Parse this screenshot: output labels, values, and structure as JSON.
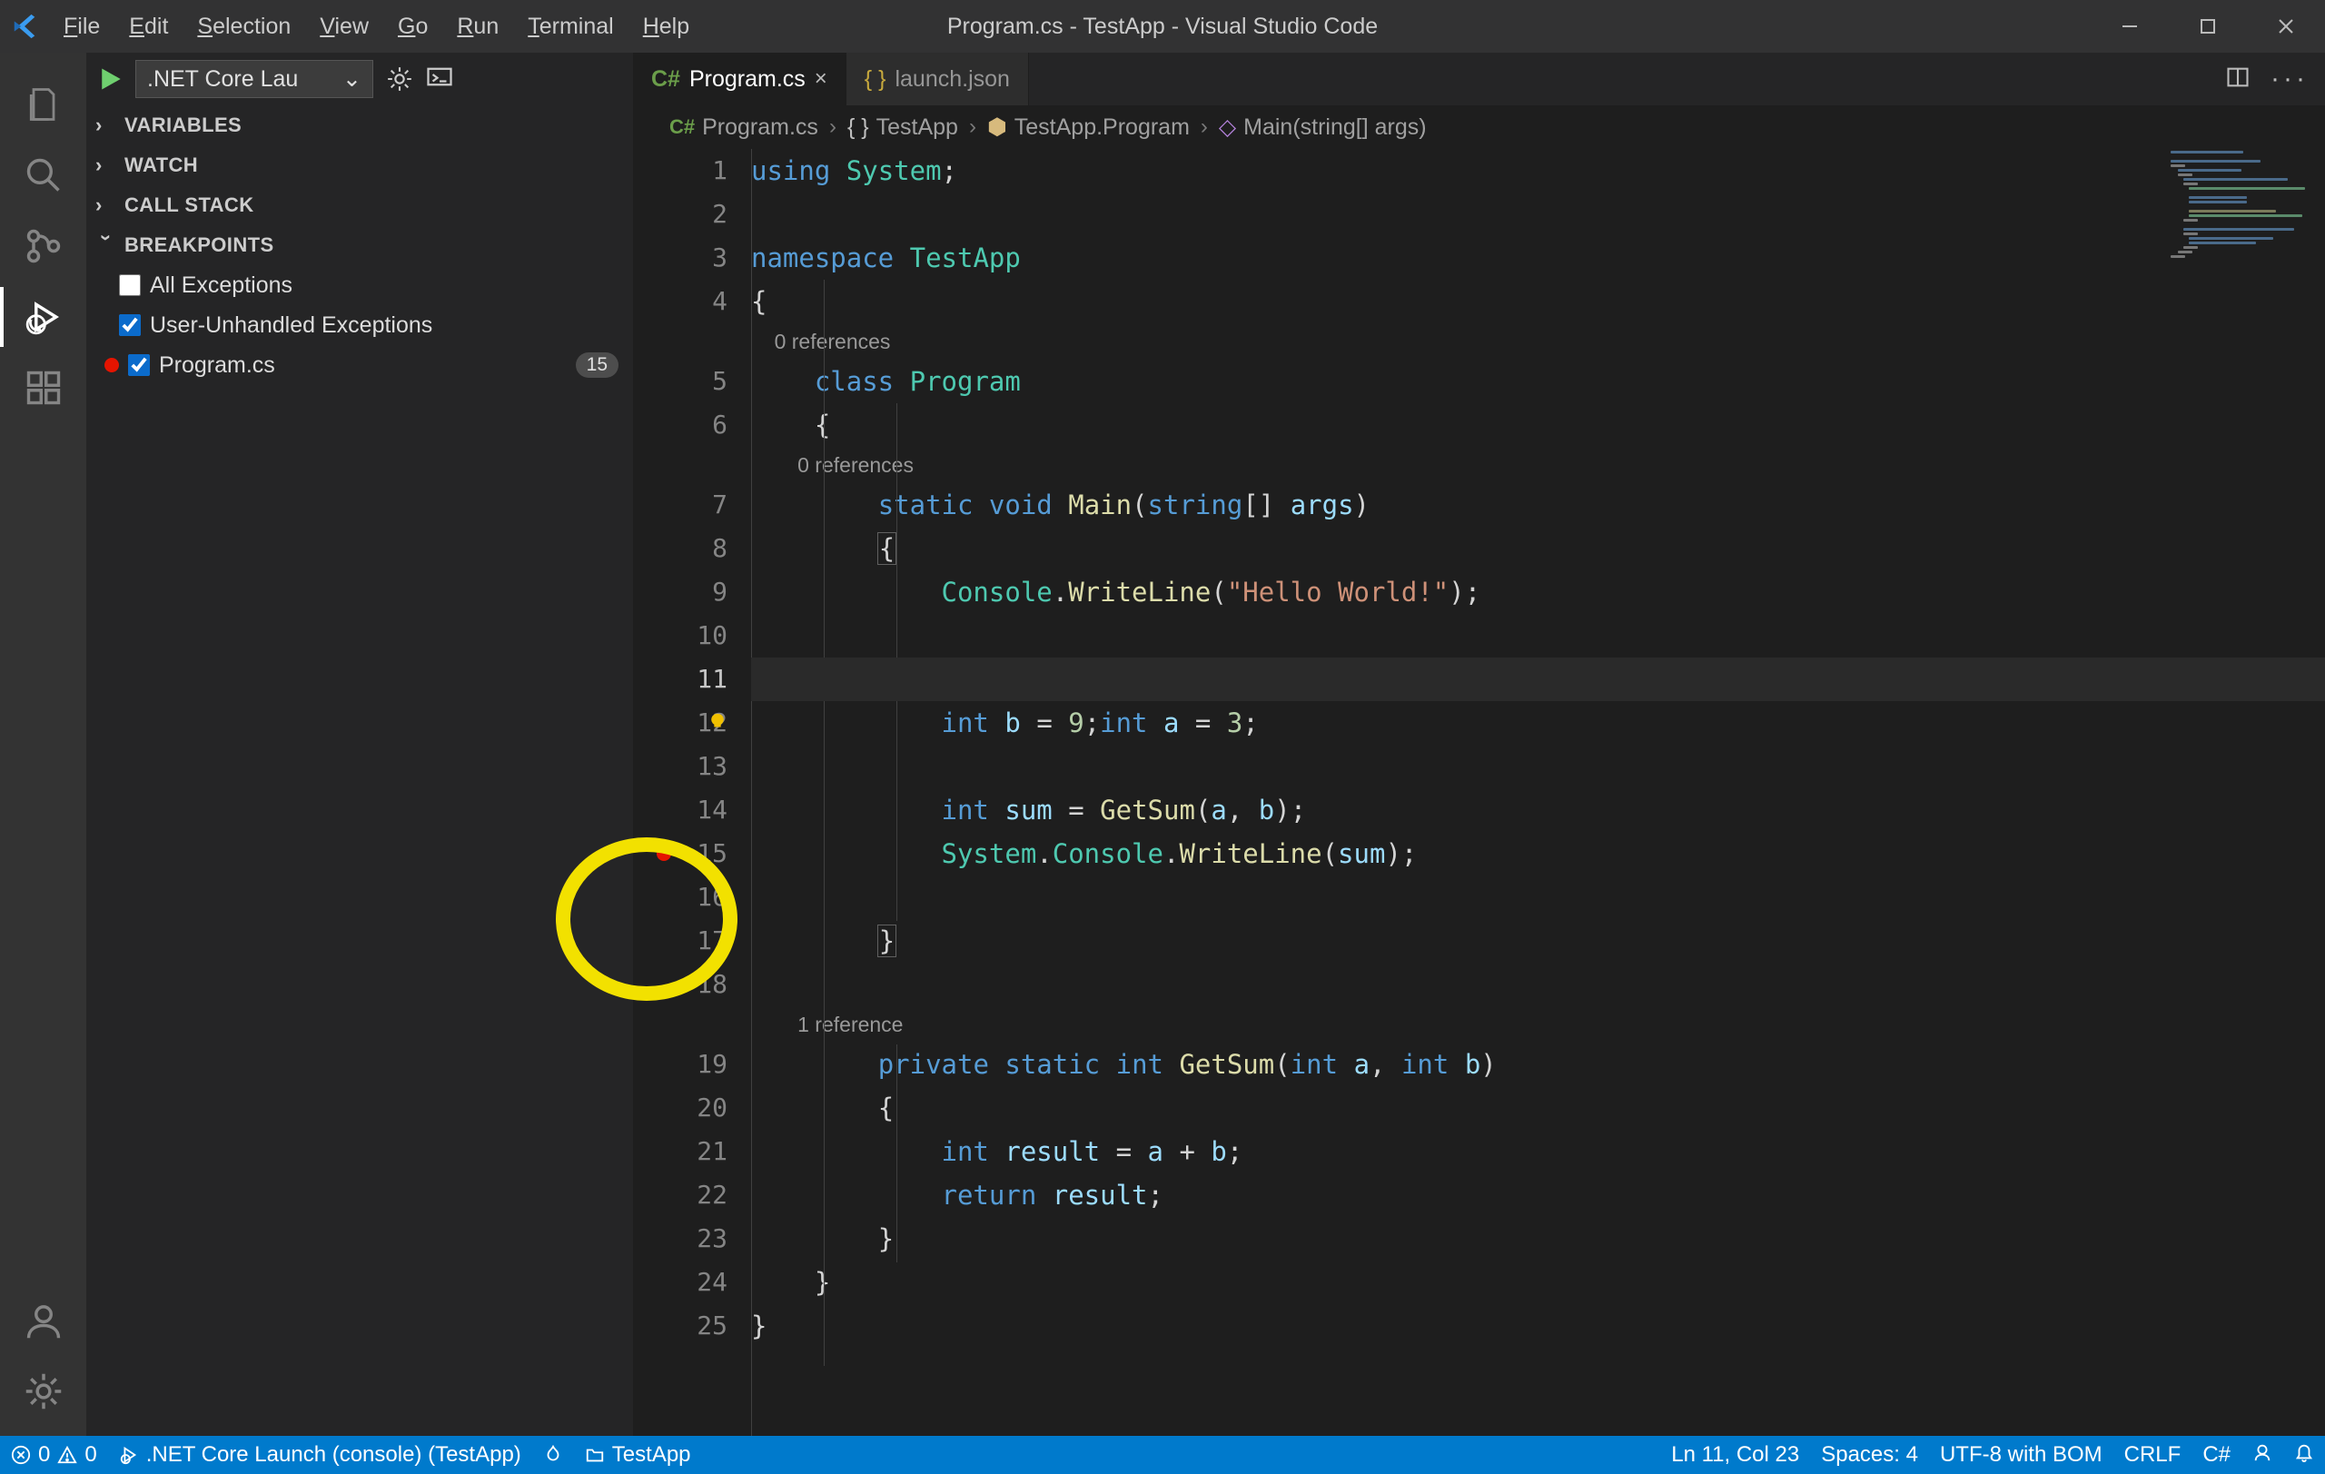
{
  "window": {
    "title": "Program.cs - TestApp - Visual Studio Code"
  },
  "menu": [
    "File",
    "Edit",
    "Selection",
    "View",
    "Go",
    "Run",
    "Terminal",
    "Help"
  ],
  "activitybar": {
    "items": [
      "files",
      "search",
      "source-control",
      "debug",
      "extensions"
    ],
    "active": "debug",
    "bottom": [
      "account",
      "settings"
    ]
  },
  "sidebar": {
    "config_label": ".NET Core Lau",
    "sections": [
      {
        "name": "VARIABLES",
        "expanded": false
      },
      {
        "name": "WATCH",
        "expanded": false
      },
      {
        "name": "CALL STACK",
        "expanded": false
      },
      {
        "name": "BREAKPOINTS",
        "expanded": true
      }
    ],
    "breakpoints": {
      "all_exceptions": {
        "label": "All Exceptions",
        "checked": false
      },
      "user_unhandled": {
        "label": "User-Unhandled Exceptions",
        "checked": true
      },
      "file": {
        "label": "Program.cs",
        "checked": true,
        "line_badge": "15"
      }
    }
  },
  "tabs": [
    {
      "label": "Program.cs",
      "icon": "csharp",
      "active": true,
      "dirty": false
    },
    {
      "label": "launch.json",
      "icon": "json",
      "active": false
    }
  ],
  "breadcrumb": [
    "Program.cs",
    "TestApp",
    "TestApp.Program",
    "Main(string[] args)"
  ],
  "code": {
    "line_numbers": [
      1,
      2,
      3,
      4,
      5,
      6,
      7,
      8,
      9,
      10,
      11,
      12,
      13,
      14,
      15,
      16,
      17,
      18,
      19,
      20,
      21,
      22,
      23,
      24,
      25
    ],
    "codelens": {
      "refs0a": "0 references",
      "refs0b": "0 references",
      "refs1": "1 reference"
    },
    "tokens": {
      "using": "using",
      "system": "System",
      "semi": ";",
      "namespace": "namespace",
      "testapp": "TestApp",
      "class": "class",
      "program": "Program",
      "static": "static",
      "void": "void",
      "main": "Main",
      "string_arr": "string",
      "args": "args",
      "console": "Console",
      "writeline": "WriteLine",
      "hello": "\"Hello World!\"",
      "int": "int",
      "a": "a",
      "eq": "=",
      "three": "3",
      "b": "b",
      "nine": "9",
      "sum": "sum",
      "getsum": "GetSum",
      "systemdot": "System",
      "private": "private",
      "result": "result",
      "return": "return",
      "lbrace": "{",
      "rbrace": "}",
      "lpar": "(",
      "rpar": ")",
      "lbr": "[",
      "rbr": "]",
      "comma": ",",
      "plus": "+"
    },
    "current_line": 11,
    "breakpoint_line": 15
  },
  "status": {
    "errors": "0",
    "warnings": "0",
    "launch": ".NET Core Launch (console) (TestApp)",
    "folder": "TestApp",
    "lncol": "Ln 11, Col 23",
    "spaces": "Spaces: 4",
    "encoding": "UTF-8 with BOM",
    "eol": "CRLF",
    "lang": "C#"
  }
}
